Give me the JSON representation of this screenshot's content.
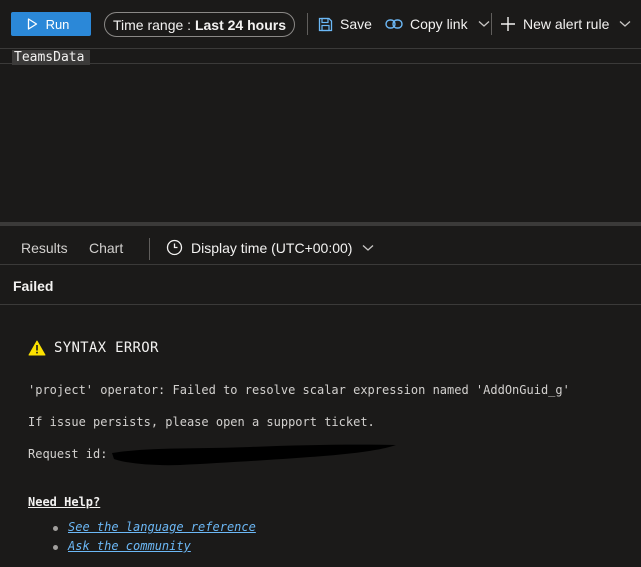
{
  "toolbar": {
    "run_label": "Run",
    "time_range_prefix": "Time range : ",
    "time_range_value": "Last 24 hours",
    "save_label": "Save",
    "copy_link_label": "Copy link",
    "new_alert_label": "New alert rule"
  },
  "editor": {
    "query": "TeamsData"
  },
  "results": {
    "tabs": [
      "Results",
      "Chart"
    ],
    "display_time": "Display time (UTC+00:00)",
    "status": "Failed"
  },
  "error": {
    "title": "SYNTAX ERROR",
    "message": "'project' operator: Failed to resolve scalar expression named 'AddOnGuid_g'",
    "support": "If issue persists, please open a support ticket.",
    "request_id_label": "Request id:"
  },
  "help": {
    "heading": "Need Help?",
    "links": [
      "See the language reference",
      "Ask the community"
    ]
  },
  "colors": {
    "accent": "#2b88d8",
    "link": "#6cb8f6",
    "warning": "#fce100",
    "background": "#1b1a19"
  }
}
